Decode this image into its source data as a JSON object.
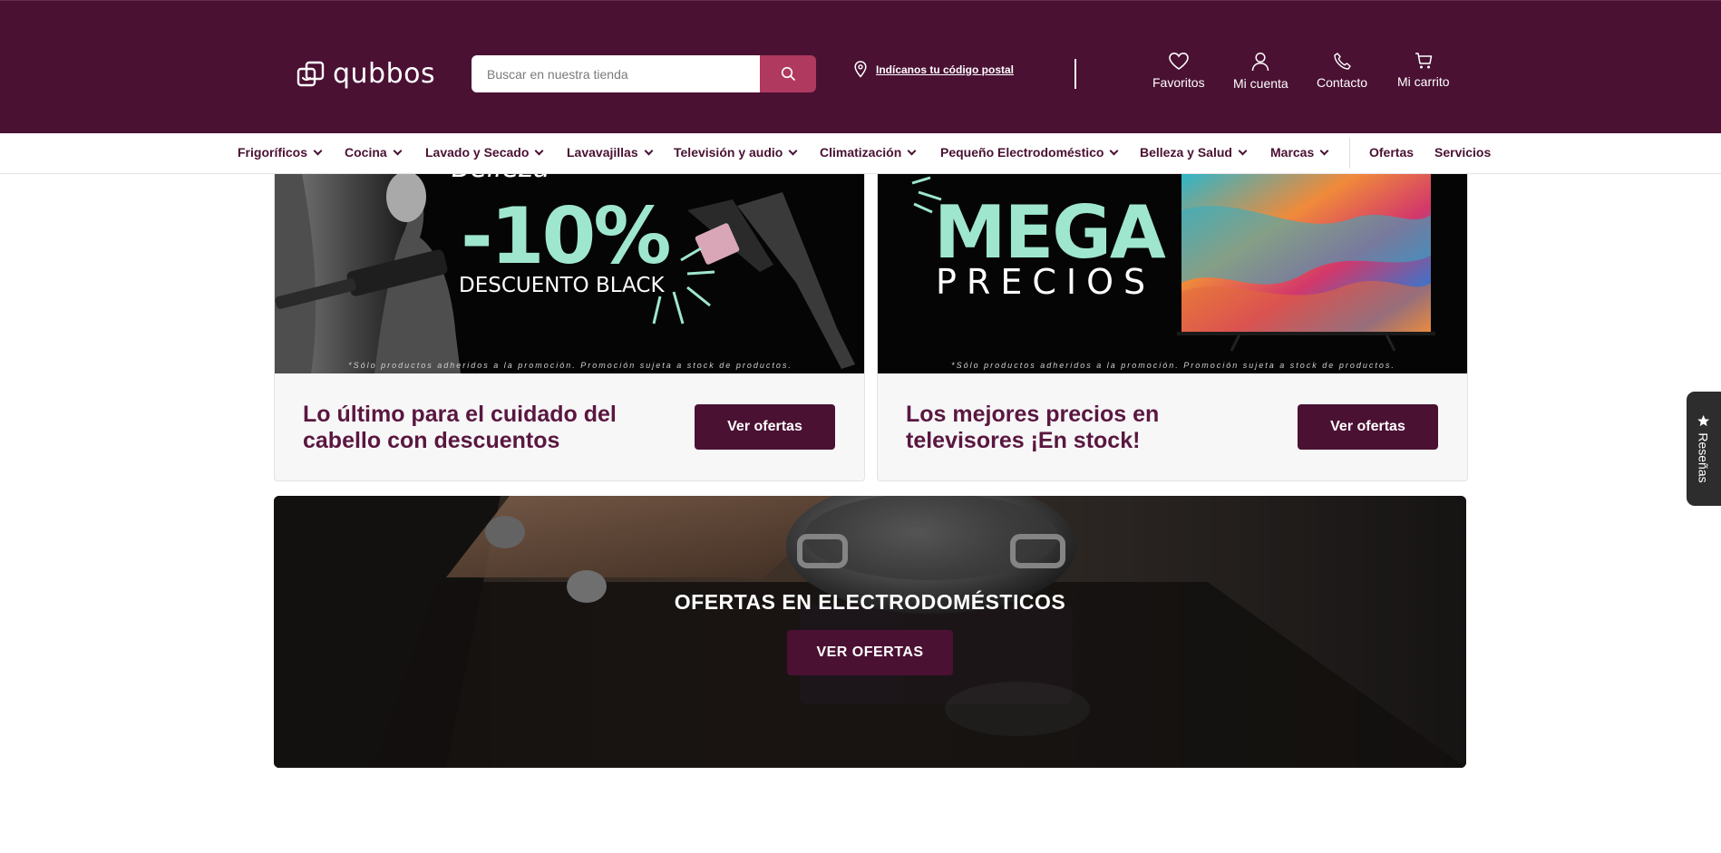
{
  "header": {
    "logo_text": "qubbos",
    "search_placeholder": "Buscar en nuestra tienda",
    "postal_link": "Indícanos tu código postal",
    "nav": [
      {
        "label": "Favoritos",
        "icon": "heart-icon"
      },
      {
        "label": "Mi cuenta",
        "icon": "user-icon"
      },
      {
        "label": "Contacto",
        "icon": "phone-icon"
      },
      {
        "label": "Mi carrito",
        "icon": "cart-icon"
      }
    ]
  },
  "categories": [
    {
      "label": "Frigoríficos",
      "has_dropdown": true
    },
    {
      "label": "Cocina",
      "has_dropdown": true
    },
    {
      "label": "Lavado y Secado",
      "has_dropdown": true
    },
    {
      "label": "Lavavajillas",
      "has_dropdown": true
    },
    {
      "label": "Televisión y audio",
      "has_dropdown": true
    },
    {
      "label": "Climatización",
      "has_dropdown": true
    },
    {
      "label": "Pequeño Electrodoméstico",
      "has_dropdown": true
    },
    {
      "label": "Belleza y Salud",
      "has_dropdown": true
    },
    {
      "label": "Marcas",
      "has_dropdown": true
    },
    {
      "label": "Ofertas",
      "has_dropdown": false
    },
    {
      "label": "Servicios",
      "has_dropdown": false
    }
  ],
  "promos": [
    {
      "banner_top_text": "Belleza",
      "banner_big": "-10%",
      "banner_sub": "DESCUENTO BLACK",
      "fine_print": "*Sólo productos adheridos a la promoción. Promoción sujeta a stock de productos.",
      "title": "Lo último para el cuidado del cabello con descuentos",
      "button": "Ver ofertas"
    },
    {
      "banner_big": "MEGA",
      "banner_sub": "PRECIOS",
      "fine_print": "*Sólo productos adheridos a la promoción. Promoción sujeta a stock de productos.",
      "title": "Los mejores precios en televisores ¡En stock!",
      "button": "Ver ofertas"
    }
  ],
  "hero": {
    "title": "OFERTAS EN ELECTRODOMÉSTICOS",
    "button": "VER OFERTAS"
  },
  "reviews_tab": {
    "label": "Reseñas"
  },
  "colors": {
    "brand": "#4a1133",
    "search_button": "#b0395f",
    "promo_accent": "#9fe6cf"
  }
}
